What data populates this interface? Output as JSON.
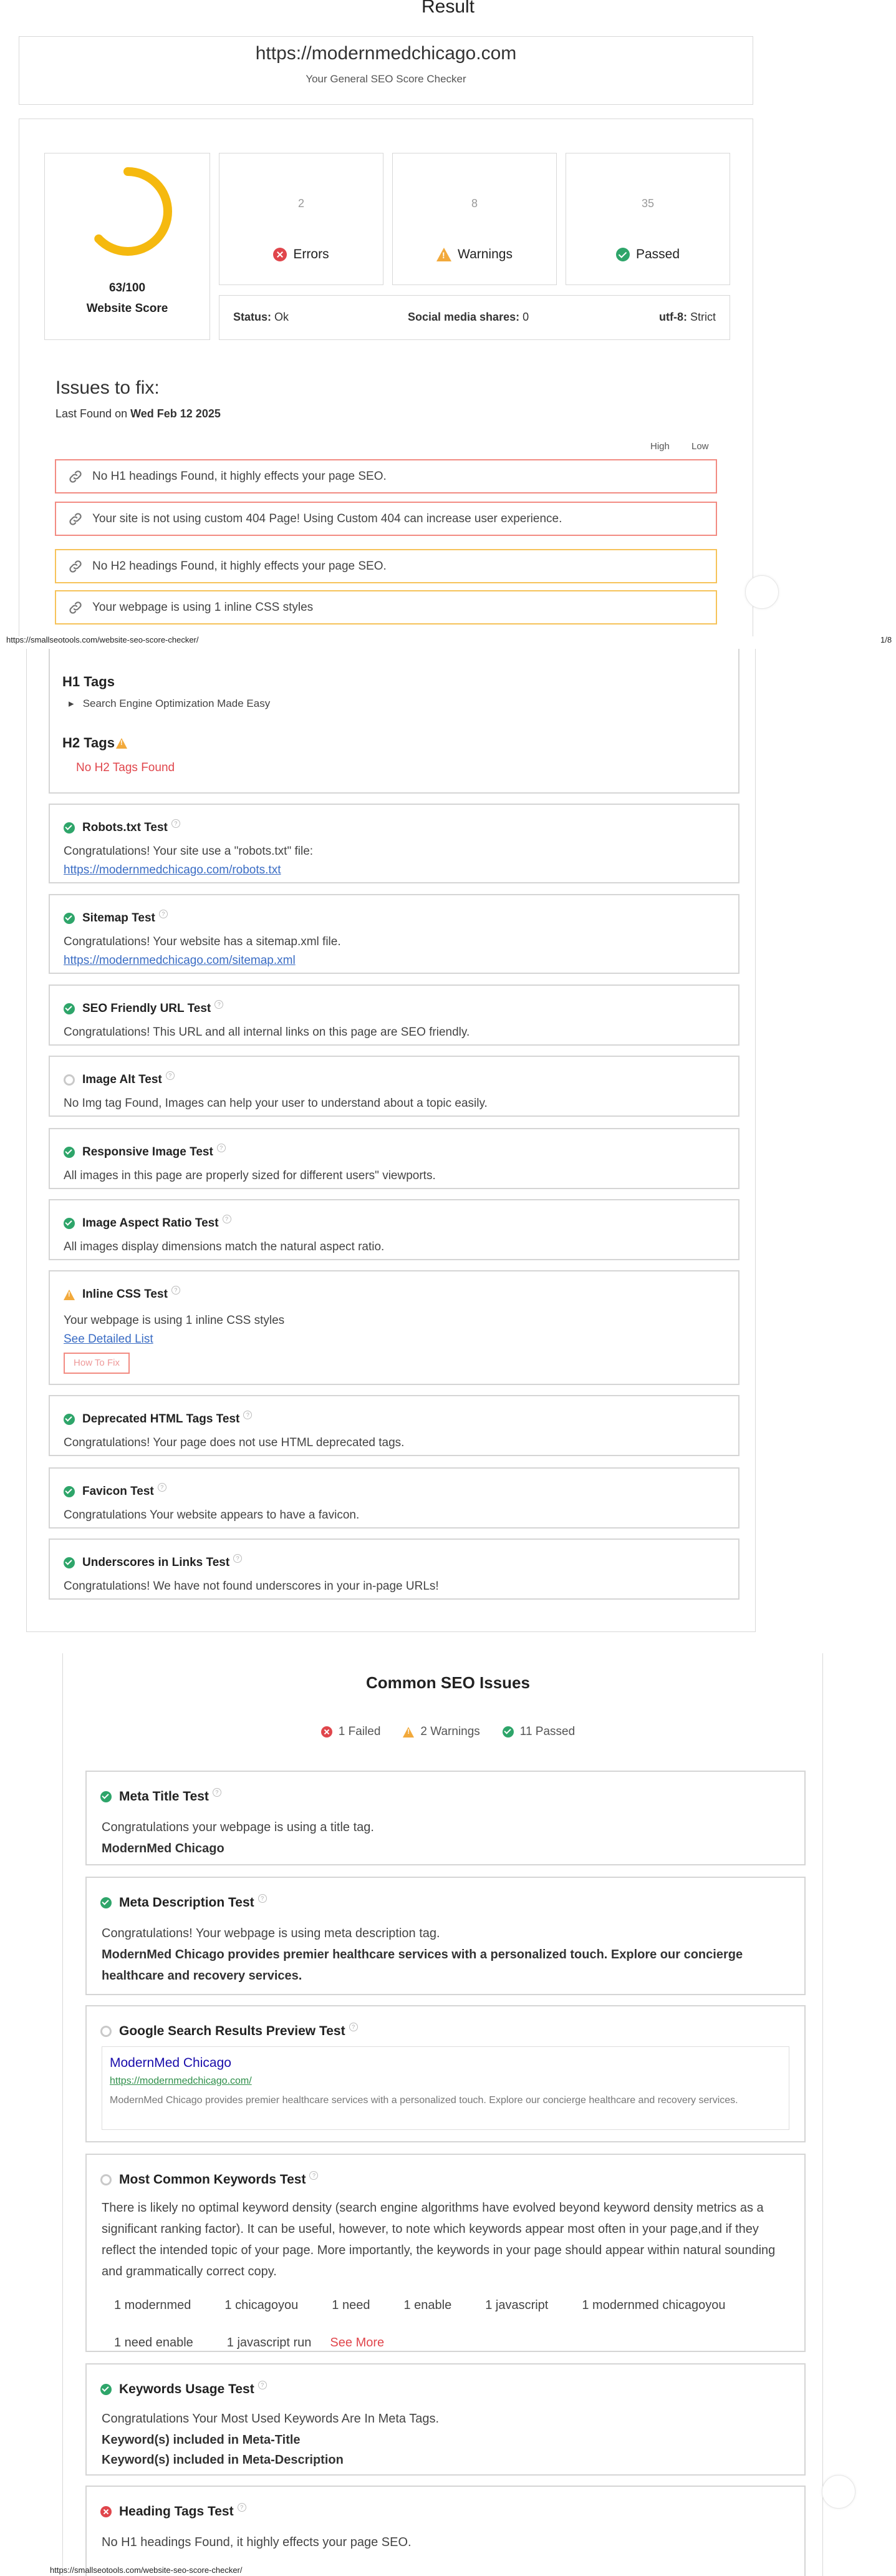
{
  "page": {
    "title": "Result",
    "site_url": "https://modernmedchicago.com",
    "subtitle": "Your General SEO Score Checker",
    "score_text": "63/100",
    "score_value": 63,
    "score_label": "Website Score",
    "stats": {
      "errors_count": "2",
      "errors_label": "Errors",
      "warnings_count": "8",
      "warnings_label": "Warnings",
      "passed_count": "35",
      "passed_label": "Passed"
    },
    "status_bar": {
      "status_label": "Status:",
      "status_value": "Ok",
      "social_label": "Social media shares:",
      "social_value": "0",
      "charset_label": "utf-8:",
      "charset_value": "Strict"
    },
    "issues": {
      "heading": "Issues to fix:",
      "last_found_prefix": "Last Found on",
      "last_found_date": "Wed Feb 12 2025",
      "legend_high": "High",
      "legend_low": "Low",
      "items": [
        "No H1 headings Found, it highly effects your page SEO.",
        "Your site is not using custom 404 Page! Using Custom 404 can increase user experience.",
        "No H2 headings Found, it highly effects your page SEO.",
        "Your webpage is using 1 inline CSS styles"
      ]
    },
    "footer_url": "https://smallseotools.com/website-seo-score-checker/",
    "page_number": "1/8",
    "colors": {
      "score_ring": "#f5b90f",
      "error": "#e0464c",
      "warning": "#f2a93b",
      "pass": "#2ea56a"
    }
  },
  "headings_section": {
    "h1_title": "H1 Tags",
    "h1_item": "Search Engine Optimization Made Easy",
    "h2_title": "H2 Tags",
    "h2_missing": "No H2 Tags Found"
  },
  "tests": {
    "robots": {
      "title": "Robots.txt Test",
      "msg": "Congratulations! Your site use a \"robots.txt\" file:",
      "link": "https://modernmedchicago.com/robots.txt"
    },
    "sitemap": {
      "title": "Sitemap Test",
      "msg": "Congratulations! Your website has a sitemap.xml file.",
      "link": "https://modernmedchicago.com/sitemap.xml"
    },
    "seo_url": {
      "title": "SEO Friendly URL Test",
      "msg": "Congratulations! This URL and all internal links on this page are SEO friendly."
    },
    "img_alt": {
      "title": "Image Alt Test",
      "msg": "No Img tag Found, Images can help your user to understand about a topic easily."
    },
    "responsive_img": {
      "title": "Responsive Image Test",
      "msg": "All images in this page are properly sized for different users\" viewports."
    },
    "aspect_ratio": {
      "title": "Image Aspect Ratio Test",
      "msg": "All images display dimensions match the natural aspect ratio."
    },
    "inline_css": {
      "title": "Inline CSS Test",
      "msg": "Your webpage is using 1 inline CSS styles",
      "link": "See Detailed List",
      "fix_button": "How To Fix"
    },
    "deprecated": {
      "title": "Deprecated HTML Tags Test",
      "msg": "Congratulations! Your page does not use HTML deprecated tags."
    },
    "favicon": {
      "title": "Favicon Test",
      "msg": "Congratulations Your website appears to have a favicon."
    },
    "underscores": {
      "title": "Underscores in Links Test",
      "msg": "Congratulations! We have not found underscores in your in-page URLs!"
    }
  },
  "common": {
    "heading": "Common SEO Issues",
    "failed": "1 Failed",
    "warnings": "2 Warnings",
    "passed": "11 Passed",
    "meta_title": {
      "title": "Meta Title Test",
      "msg": "Congratulations your webpage is using a title tag.",
      "value": "ModernMed Chicago"
    },
    "meta_desc": {
      "title": "Meta Description Test",
      "msg": "Congratulations! Your webpage is using meta description tag.",
      "value": "ModernMed Chicago provides premier healthcare services with a personalized touch. Explore our concierge healthcare and recovery services."
    },
    "serp": {
      "title": "Google Search Results Preview Test",
      "preview_title": "ModernMed Chicago",
      "preview_url": "https://modernmedchicago.com/",
      "preview_desc": "ModernMed Chicago provides premier healthcare services with a personalized touch. Explore our concierge healthcare and recovery services."
    },
    "keywords": {
      "title": "Most Common Keywords Test",
      "msg": "There is likely no optimal keyword density (search engine algorithms have evolved beyond keyword density metrics as a significant ranking factor). It can be useful, however, to note which keywords appear most often in your page,and if they reflect the intended topic of your page. More importantly, the keywords in your page should appear within natural sounding and grammatically correct copy.",
      "items": [
        "1 modernmed",
        "1 chicagoyou",
        "1 need",
        "1 enable",
        "1 javascript",
        "1 modernmed chicagoyou",
        "1 need enable",
        "1 javascript run"
      ],
      "see_more": "See More"
    },
    "kw_usage": {
      "title": "Keywords Usage Test",
      "msg": "Congratulations Your Most Used Keywords Are In Meta Tags.",
      "line1": "Keyword(s) included in Meta-Title",
      "line2": "Keyword(s) included in Meta-Description"
    },
    "heading_tags": {
      "title": "Heading Tags Test",
      "msg": "No H1 headings Found, it highly effects your page SEO."
    }
  },
  "footer2_url": "https://smallseotools.com/website-seo-score-checker/"
}
